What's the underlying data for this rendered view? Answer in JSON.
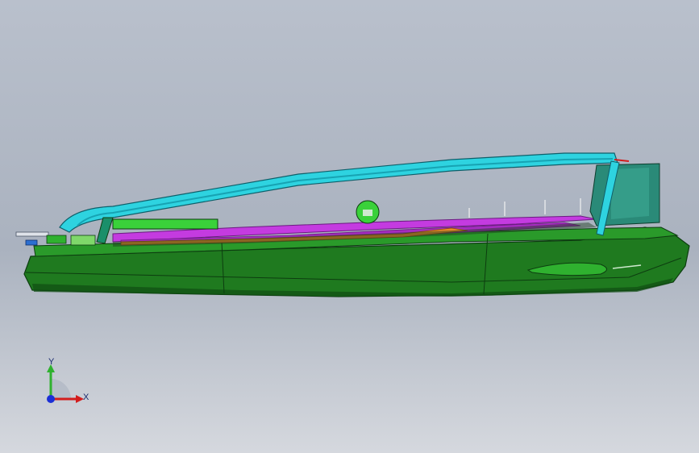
{
  "viewport": {
    "model": "boat-hull-assembly",
    "view": "side-view",
    "colors": {
      "background_top": "#b9c0cc",
      "background_bottom": "#d5d8de",
      "hull": "#1f7a1f",
      "hull_dark": "#0f4d12",
      "canopy_frame": "#2ed3e0",
      "cabin_glass": "#2a8a78",
      "interior_rails": "#c43be0",
      "interior_detail": "#e8892a"
    }
  },
  "triad": {
    "x_label": "X",
    "y_label": "Y",
    "colors": {
      "x": "#d31d1d",
      "y": "#2fb12f",
      "z": "#1b2fd6"
    }
  }
}
